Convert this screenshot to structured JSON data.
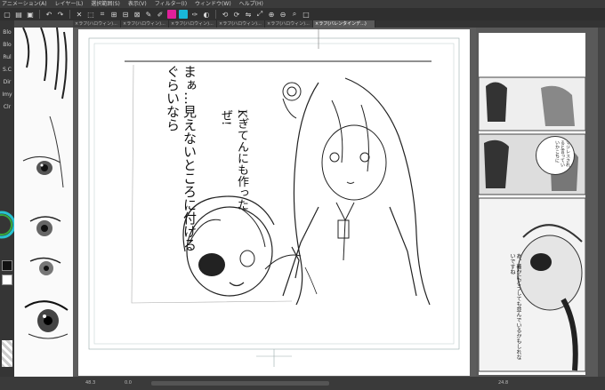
{
  "menu": {
    "items": [
      "アニメーション(A)",
      "レイヤー(L)",
      "選択範囲(S)",
      "表示(V)",
      "フィルター(I)",
      "ウィンドウ(W)",
      "ヘルプ(H)"
    ]
  },
  "tabs": {
    "items": [
      "×ラフ(ハロウィン)...",
      "×ラフ(ハロウィン)...",
      "×ラフ(ハロウィン)...",
      "×ラフ(ハロウィン)...",
      "×ラフ(ハロウィン)...",
      "×ラフ(バレンタインデ...)"
    ],
    "active_index": 5
  },
  "left_tools": {
    "labels": [
      "Blo",
      "Blo",
      "Rul",
      "S.C",
      "Dir",
      "Imy",
      "Clr"
    ]
  },
  "canvas": {
    "handwriting_left": "まぁ…見えないところに付けるぐらいなら",
    "handwriting_right": "Kぎてんにも作ったぜ!"
  },
  "right_panel": {
    "comic_text_1": "マジレスされると言っていいかこちに",
    "comic_text_2": "あ、確かにどうしても並んでいるかもしれないですね"
  },
  "status": {
    "zoom_left": "48.3",
    "zoom_right": "24.8",
    "coords": "0.0"
  }
}
